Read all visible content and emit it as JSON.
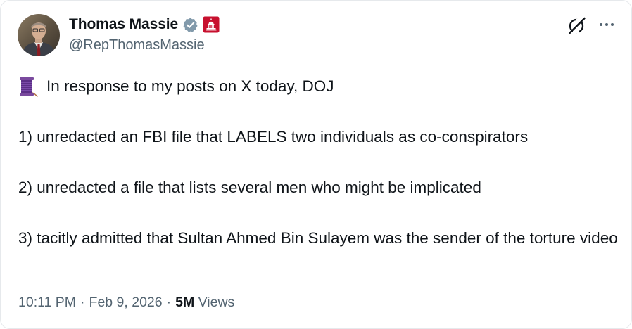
{
  "author": {
    "display_name": "Thomas Massie",
    "handle": "@RepThomasMassie",
    "verified_badge": "grey-checkmark",
    "affiliate_badge": "us-capitol-badge"
  },
  "icons": {
    "grok": "grok-icon",
    "more": "more-icon",
    "thread": "thread-spool-icon"
  },
  "colors": {
    "text": "#0f1419",
    "secondary": "#536471",
    "verified_grey": "#829aab",
    "capitol_badge": "#c7102e"
  },
  "tweet": {
    "intro": "In response to my posts on X today, DOJ",
    "line1": "1) unredacted an FBI file that LABELS two individuals as co-conspirators",
    "line2": "2) unredacted a file that lists several men who might be implicated",
    "line3": "3) tacitly admitted that Sultan Ahmed Bin Sulayem was the sender of the torture video"
  },
  "meta": {
    "time": "10:11 PM",
    "date": "Feb 9, 2026",
    "separator": "·",
    "views_count": "5M",
    "views_label": "Views"
  }
}
